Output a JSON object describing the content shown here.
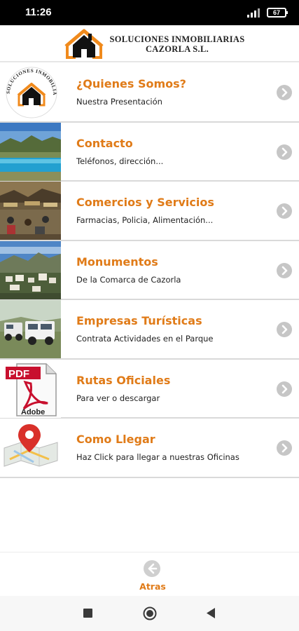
{
  "status_bar": {
    "time": "11:26",
    "battery_level": "67",
    "signal_icon": "signal-icon",
    "battery_icon": "battery-icon"
  },
  "header": {
    "logo_icon": "house-logo-icon",
    "title_line1": "SOLUCIONES INMOBILIARIAS",
    "title_line2": "CAZORLA S.L."
  },
  "menu": {
    "items": [
      {
        "title": "¿Quienes Somos?",
        "subtitle": "Nuestra Presentación",
        "thumb": "company-seal-logo"
      },
      {
        "title": "Contacto",
        "subtitle": "Teléfonos, dirección...",
        "thumb": "lake-landscape-photo"
      },
      {
        "title": "Comercios y Servicios",
        "subtitle": "Farmacias, Policia, Alimentación...",
        "thumb": "street-terrace-photo"
      },
      {
        "title": "Monumentos",
        "subtitle": "De la Comarca de Cazorla",
        "thumb": "village-panorama-photo"
      },
      {
        "title": "Empresas Turísticas",
        "subtitle": "Contrata Actividades en el Parque",
        "thumb": "jeeps-photo"
      },
      {
        "title": "Rutas Oficiales",
        "subtitle": "Para ver o descargar",
        "thumb": "pdf-document-icon"
      },
      {
        "title": "Como Llegar",
        "subtitle": "Haz Click para llegar a nuestras Oficinas",
        "thumb": "map-pin-icon"
      }
    ],
    "chevron_icon": "chevron-right-circle-icon"
  },
  "footer": {
    "back_label": "Atras",
    "back_icon": "back-arrow-circle-icon"
  },
  "nav_bar": {
    "recents_icon": "recents-square-icon",
    "home_icon": "home-circle-icon",
    "back_icon": "back-triangle-icon"
  },
  "logo_text": {
    "seal_text": "SOLUCIONES INMOBILIARIAS CAZORLA S. L.",
    "pdf_label": "PDF",
    "adobe_label": "Adobe"
  },
  "colors": {
    "accent_orange": "#e07b18",
    "divider": "#d9d9d9"
  }
}
